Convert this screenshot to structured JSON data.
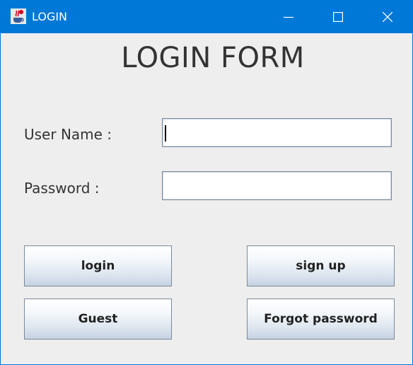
{
  "window": {
    "title": "LOGIN",
    "titlebar_color": "#0078d7",
    "icons": {
      "app": "java-cup-icon",
      "minimize": "minimize-icon",
      "maximize": "maximize-icon",
      "close": "close-icon"
    }
  },
  "form": {
    "heading": "LOGIN FORM",
    "username_label": "User Name :",
    "username_value": "",
    "password_label": "Password :",
    "password_value": ""
  },
  "buttons": {
    "login": "login",
    "signup": "sign up",
    "guest": "Guest",
    "forgot": "Forgot password"
  }
}
